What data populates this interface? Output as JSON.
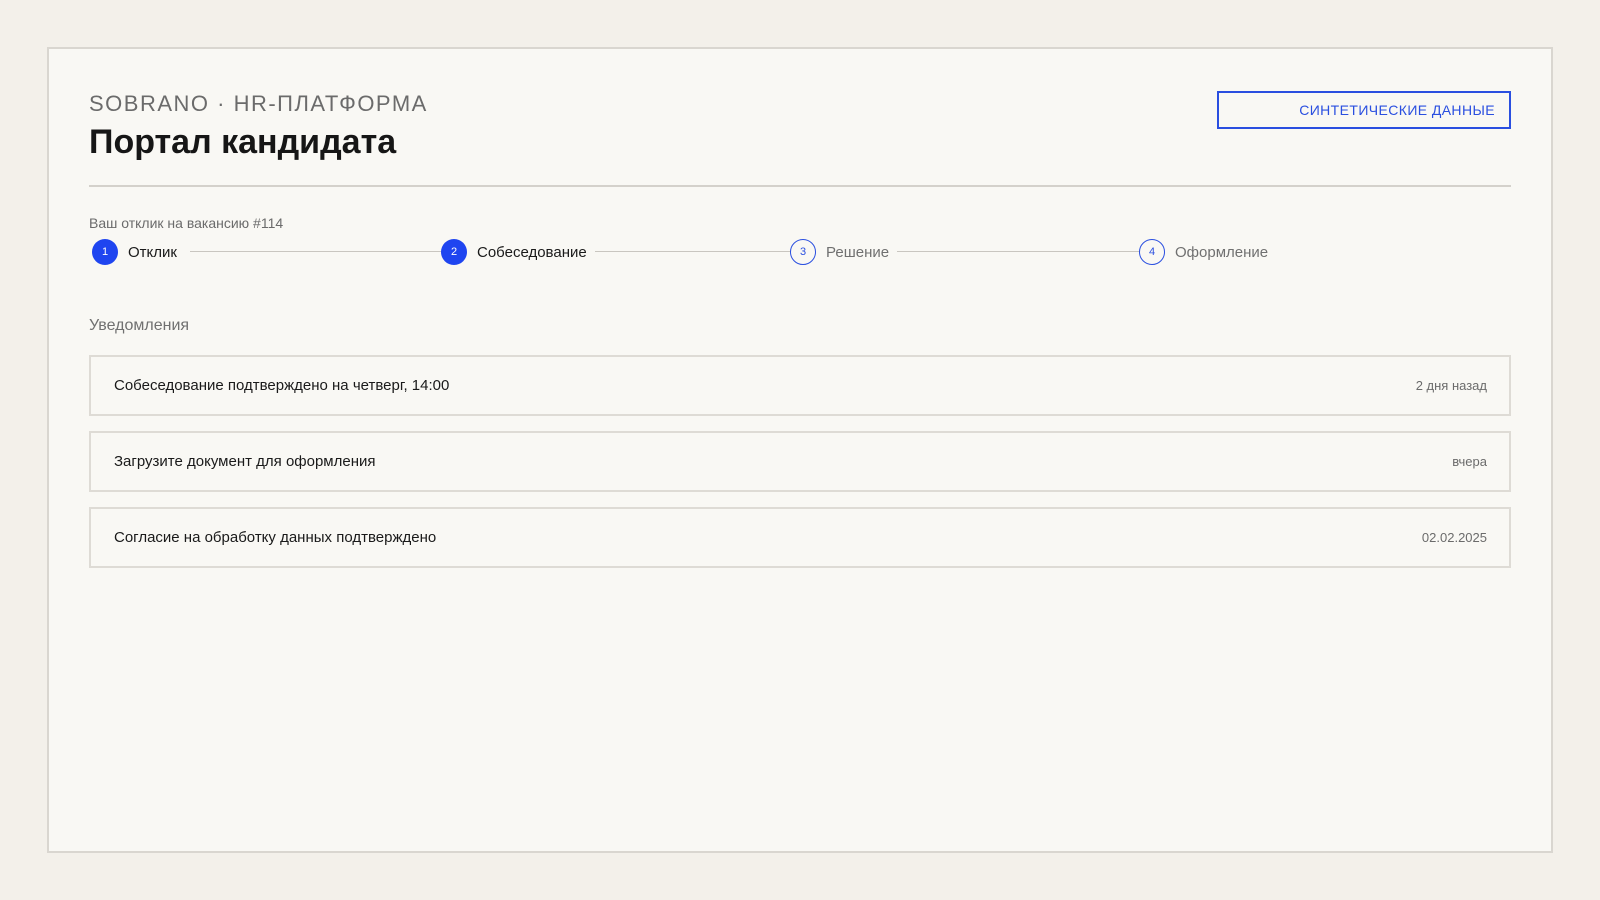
{
  "header": {
    "brand": "SOBRANO · HR-ПЛАТФОРМА",
    "title": "Портал кандидата",
    "badge": "СИНТЕТИЧЕСКИЕ ДАННЫЕ"
  },
  "progress": {
    "caption": "Ваш отклик на вакансию #114",
    "steps": [
      {
        "number": "1",
        "label": "Отклик",
        "status": "done"
      },
      {
        "number": "2",
        "label": "Собеседование",
        "status": "current"
      },
      {
        "number": "3",
        "label": "Решение",
        "status": "pending"
      },
      {
        "number": "4",
        "label": "Оформление",
        "status": "pending"
      }
    ]
  },
  "notifications": {
    "heading": "Уведомления",
    "items": [
      {
        "text": "Собеседование подтверждено на четверг, 14:00",
        "time": "2 дня назад"
      },
      {
        "text": "Загрузите документ для оформления",
        "time": "вчера"
      },
      {
        "text": "Согласие на обработку данных подтверждено",
        "time": "02.02.2025"
      }
    ]
  },
  "colors": {
    "accent": "#1f45f0",
    "background": "#f3f0ea",
    "panel": "#f9f8f4"
  }
}
